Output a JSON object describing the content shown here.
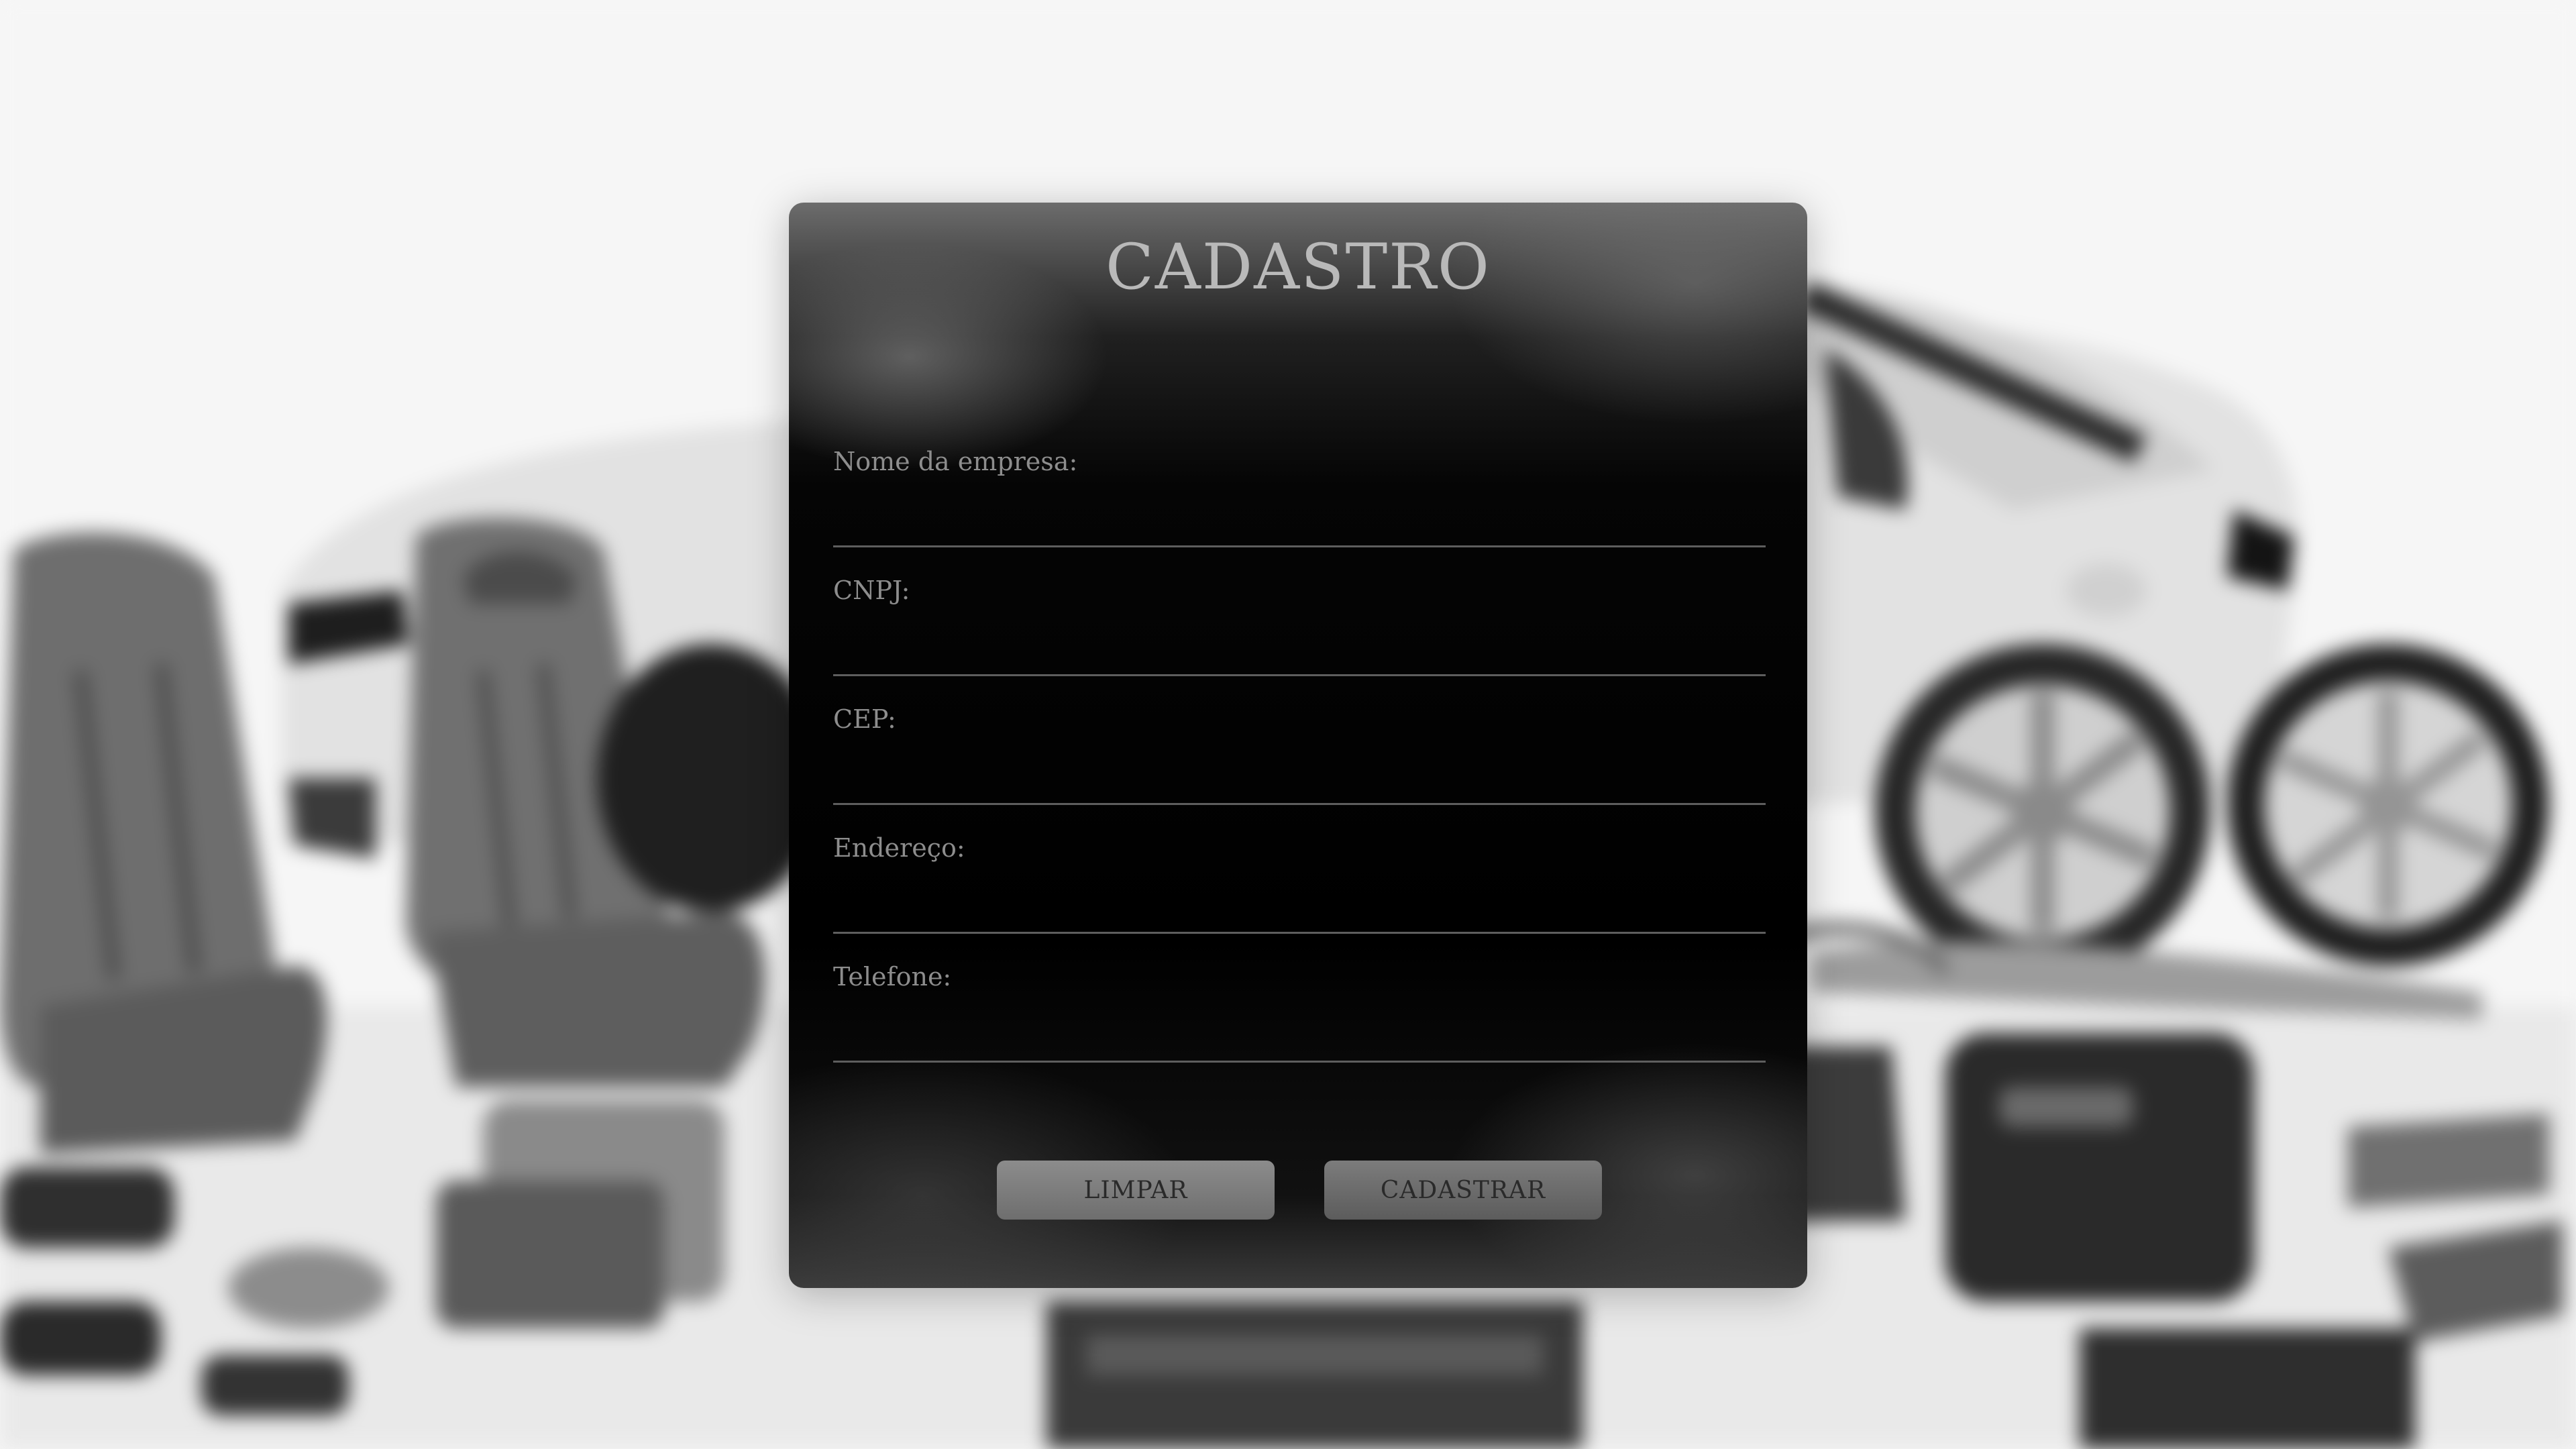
{
  "form": {
    "title": "CADASTRO",
    "fields": [
      {
        "label": "Nome da empresa:",
        "value": ""
      },
      {
        "label": "CNPJ:",
        "value": ""
      },
      {
        "label": "CEP:",
        "value": ""
      },
      {
        "label": "Endereço:",
        "value": ""
      },
      {
        "label": "Telefone:",
        "value": ""
      }
    ],
    "buttons": {
      "clear_label": "LIMPAR",
      "submit_label": "CADASTRAR"
    }
  },
  "background": {
    "description_icons": [
      "car-icon",
      "car-seat-icon",
      "wheel-icon",
      "engine-parts-icon"
    ],
    "palette": {
      "light": "#f6f6f6",
      "mid": "#9a9a9a",
      "dark": "#2b2b2b"
    }
  }
}
